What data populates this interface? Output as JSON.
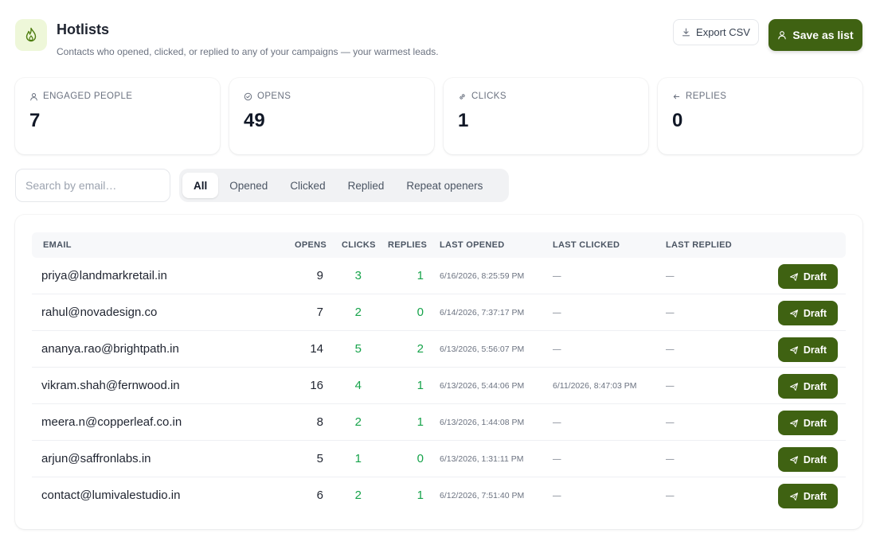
{
  "header": {
    "logo_icon": "flame-icon",
    "title": "Hotlists",
    "subtitle": "Contacts who opened, clicked, or replied to any of your campaigns — your warmest leads.",
    "export_label": "Export CSV",
    "export_icon": "download-icon",
    "save_label": "Save as list",
    "save_icon": "users-icon"
  },
  "stats": [
    {
      "label": "ENGAGED PEOPLE",
      "value": "7",
      "icon": "users-icon"
    },
    {
      "label": "OPENS",
      "value": "49",
      "icon": "check-circle-icon"
    },
    {
      "label": "CLICKS",
      "value": "1",
      "icon": "link-icon"
    },
    {
      "label": "REPLIES",
      "value": "0",
      "icon": "reply-icon"
    }
  ],
  "search": {
    "placeholder": "Search by email…"
  },
  "filters": {
    "active": "All",
    "tabs": [
      "All",
      "Opened",
      "Clicked",
      "Replied",
      "Repeat openers"
    ]
  },
  "table": {
    "headers": {
      "email": "EMAIL",
      "opens": "OPENS",
      "clicks": "CLICKS",
      "replies": "REPLIES",
      "last_opened": "LAST OPENED",
      "last_clicked": "LAST CLICKED",
      "last_replied": "LAST REPLIED"
    },
    "draft_label": "Draft",
    "rows": [
      {
        "email": "priya@landmarkretail.in",
        "opens": "9",
        "clicks": "3",
        "replies": "1",
        "last_opened": "6/16/2026, 8:25:59 PM",
        "last_clicked": "—",
        "last_replied": "—"
      },
      {
        "email": "rahul@novadesign.co",
        "opens": "7",
        "clicks": "2",
        "replies": "0",
        "last_opened": "6/14/2026, 7:37:17 PM",
        "last_clicked": "—",
        "last_replied": "—"
      },
      {
        "email": "ananya.rao@brightpath.in",
        "opens": "14",
        "clicks": "5",
        "replies": "2",
        "last_opened": "6/13/2026, 5:56:07 PM",
        "last_clicked": "—",
        "last_replied": "—"
      },
      {
        "email": "vikram.shah@fernwood.in",
        "opens": "16",
        "clicks": "4",
        "replies": "1",
        "last_opened": "6/13/2026, 5:44:06 PM",
        "last_clicked": "6/11/2026, 8:47:03 PM",
        "last_replied": "—"
      },
      {
        "email": "meera.n@copperleaf.co.in",
        "opens": "8",
        "clicks": "2",
        "replies": "1",
        "last_opened": "6/13/2026, 1:44:08 PM",
        "last_clicked": "—",
        "last_replied": "—"
      },
      {
        "email": "arjun@saffronlabs.in",
        "opens": "5",
        "clicks": "1",
        "replies": "0",
        "last_opened": "6/13/2026, 1:31:11 PM",
        "last_clicked": "—",
        "last_replied": "—"
      },
      {
        "email": "contact@lumivalestudio.in",
        "opens": "6",
        "clicks": "2",
        "replies": "1",
        "last_opened": "6/12/2026, 7:51:40 PM",
        "last_clicked": "—",
        "last_replied": "—"
      }
    ]
  },
  "colors": {
    "brand": "#3f6212",
    "positive": "#16a34a",
    "logo_bg": "#eef7d9"
  }
}
